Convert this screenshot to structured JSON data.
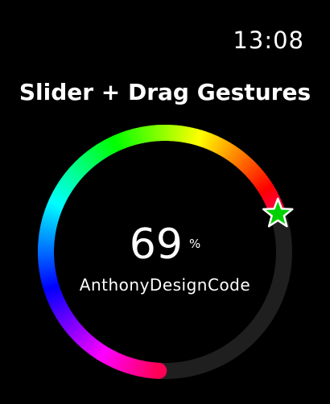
{
  "status_bar": {
    "time": "13:08"
  },
  "screen": {
    "title": "Slider + Drag Gestures"
  },
  "slider": {
    "value": 69,
    "unit": "%",
    "caption": "AnthonyDesignCode",
    "handle_icon": "star-icon",
    "track_color": "#1f1f1f",
    "handle_color": "#00d000"
  }
}
